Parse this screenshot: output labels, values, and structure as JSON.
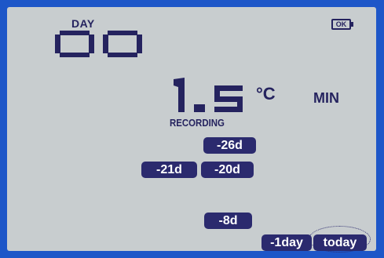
{
  "display": {
    "day_label": "DAY",
    "day_value": "00",
    "battery_label": "OK",
    "temperature": "1.5",
    "unit": "°C",
    "mode": "MIN",
    "status": "RECORDING"
  },
  "history_buttons": [
    {
      "label": "-26d"
    },
    {
      "label": "-21d"
    },
    {
      "label": "-20d"
    },
    {
      "label": "-8d"
    },
    {
      "label": "-1day"
    },
    {
      "label": "today"
    }
  ],
  "colors": {
    "frame": "#1d56c8",
    "lcd_background": "#c8cdcf",
    "segment": "#25235f",
    "button": "#2b2a6e"
  },
  "icons": [
    "battery-icon"
  ]
}
